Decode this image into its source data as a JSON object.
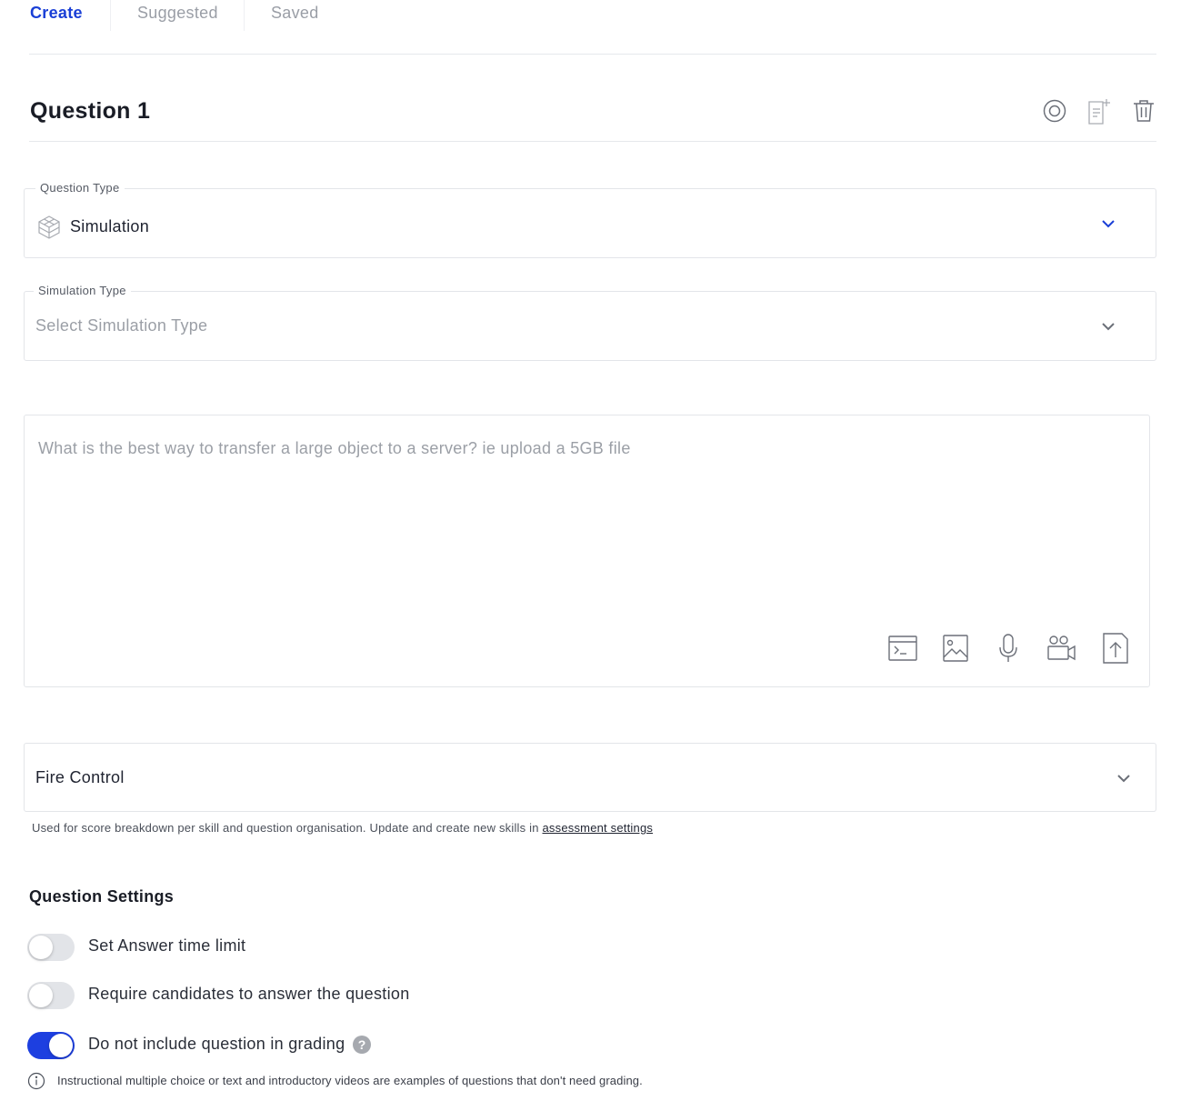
{
  "tabs": [
    {
      "label": "Create",
      "active": true
    },
    {
      "label": "Suggested",
      "active": false
    },
    {
      "label": "Saved",
      "active": false
    }
  ],
  "question": {
    "title": "Question 1",
    "header_icons": [
      "settings-icon",
      "add-page-icon",
      "trash-icon"
    ]
  },
  "question_type": {
    "label": "Question Type",
    "value": "Simulation",
    "icon": "cube-icon"
  },
  "simulation_type": {
    "label": "Simulation Type",
    "placeholder": "Select Simulation Type"
  },
  "question_text": {
    "placeholder": "What is the best way to transfer a large object to a server? ie upload a 5GB file",
    "tools": [
      "code-icon",
      "image-icon",
      "microphone-icon",
      "video-icon",
      "upload-icon"
    ]
  },
  "skill": {
    "value": "Fire Control",
    "hint": "Used for score breakdown per skill and question organisation. Update and create new skills in ",
    "hint_link": "assessment settings"
  },
  "settings": {
    "title": "Question Settings",
    "toggles": [
      {
        "label": "Set Answer time limit",
        "on": false
      },
      {
        "label": "Require candidates to answer the question",
        "on": false
      },
      {
        "label": "Do not include question in grading",
        "on": true
      }
    ],
    "help_glyph": "?",
    "note": "Instructional multiple choice or text and introductory videos are examples of questions that don't need grading."
  },
  "colors": {
    "accent": "#1a3fd6",
    "toggle_on": "#1d3fe0"
  }
}
